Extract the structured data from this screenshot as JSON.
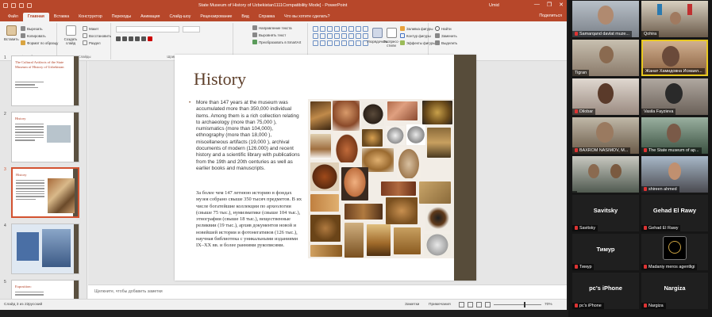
{
  "window": {
    "title": "State Museum of History of Uzbekistan1111Compatibility Mode]  -  PowerPoint",
    "user": "Umid",
    "controls": {
      "minimize": "—",
      "restore": "❐",
      "close": "✕"
    }
  },
  "ribbon_tabs": [
    "Файл",
    "Главная",
    "Вставка",
    "Конструктор",
    "Переходы",
    "Анимация",
    "Слайд-шоу",
    "Рецензирование",
    "Вид",
    "Справка",
    "Что вы хотите сделать?"
  ],
  "ribbon_tabs_active": "Главная",
  "ribbon_right": {
    "share": "Поделиться"
  },
  "ribbon": {
    "clipboard": {
      "label": "Буфер обмена",
      "paste": "Вставить",
      "cut": "Вырезать",
      "copy": "Копировать",
      "format": "Формат по образцу"
    },
    "slides": {
      "label": "Слайды",
      "new": "Создать слайд",
      "layout": "Макет",
      "reset": "Восстановить",
      "section": "Раздел"
    },
    "font": {
      "label": "Шрифт"
    },
    "paragraph": {
      "label": "Абзац",
      "direction": "Направление текста",
      "align": "Выровнять текст",
      "smartart": "Преобразовать в SmartArt"
    },
    "drawing": {
      "label": "Рисование",
      "arrange": "Упорядочить",
      "styles": "Экспресс-стили",
      "fill": "Заливка фигуры",
      "outline": "Контур фигуры",
      "effects": "Эффекты фигуры"
    },
    "editing": {
      "label": "Редактирование",
      "find": "Найти",
      "replace": "Заменить",
      "select": "Выделить"
    }
  },
  "thumbnails": [
    {
      "num": "1",
      "title": "The Cultural Artifacts of the State Museum of History of Uzbekistan"
    },
    {
      "num": "2",
      "title": "History"
    },
    {
      "num": "3",
      "title": "History"
    },
    {
      "num": "4",
      "title": ""
    },
    {
      "num": "5",
      "title": "Exposition:"
    }
  ],
  "slide": {
    "headline": "History",
    "body_en": "More than 147 years at the museum was accumulated more than 350,000 individual items. Among them is a rich collection relating to archaeology (more than 75,000 ), numismatics (more than 104,000), ethnography (more than 18,000 ), miscellaneous artifacts (19,000 ), archival documents of modern (126.000)  and recent history and a scientific library with publications from the 19th and 20th centuries as well as earlier books and manuscripts.",
    "body_ru": "За более чем 147 летнюю историю в фондах музея собрано свыше 350 тысяч предметов. В их числе богатейшие коллекции по археологии (свыше 75 тыс.), нумизматике (свыше 104 тыс.), этнографии (свыше 18 тыс.), вещественные реликвии (19 тыс.), архив документов новой и новейшей истории и  фотонегативов (126 тыс.), научная библиотека с уникальными изданиями IX–XX вв. и более ранними рукописями."
  },
  "notes_placeholder": "Щелкните, чтобы добавить заметки",
  "status": {
    "slide": "Слайд 3 из 22",
    "language": "русский",
    "notes": "Заметки",
    "comments": "Примечания",
    "zoom": "70%"
  },
  "participants": [
    {
      "name": "Samarqand davlat muze...",
      "video": true,
      "muted": true
    },
    {
      "name": "Qohira",
      "video": true,
      "muted": false
    },
    {
      "name": "Tigran",
      "video": true,
      "muted": false
    },
    {
      "name": "Жанат Хамидовна Исмаил...",
      "video": true,
      "muted": false
    },
    {
      "name": "Dilobar",
      "video": true,
      "muted": true
    },
    {
      "name": "Vasila Fayzieva",
      "video": true,
      "muted": false
    },
    {
      "name": "BAXROM NASIMOV, M...",
      "video": true,
      "muted": true
    },
    {
      "name": "The State museum of ap...",
      "video": true,
      "muted": true
    },
    {
      "name": "",
      "video": true,
      "muted": false
    },
    {
      "name": "shireen ahmed",
      "video": true,
      "muted": true
    },
    {
      "name": "Savitsky",
      "big": "Savitsky",
      "video": false,
      "muted": true
    },
    {
      "name": "Gehad El Rawy",
      "big": "Gehad El Rawy",
      "video": false,
      "muted": true
    },
    {
      "name": "Тимур",
      "big": "Тимур",
      "video": false,
      "muted": true
    },
    {
      "name": "Madaniy meros agentligi",
      "big": "",
      "video": false,
      "muted": true
    },
    {
      "name": "pc's iPhone",
      "big": "pc's iPhone",
      "video": false,
      "muted": true
    },
    {
      "name": "Nargiza",
      "big": "Nargiza",
      "video": false,
      "muted": true
    }
  ]
}
